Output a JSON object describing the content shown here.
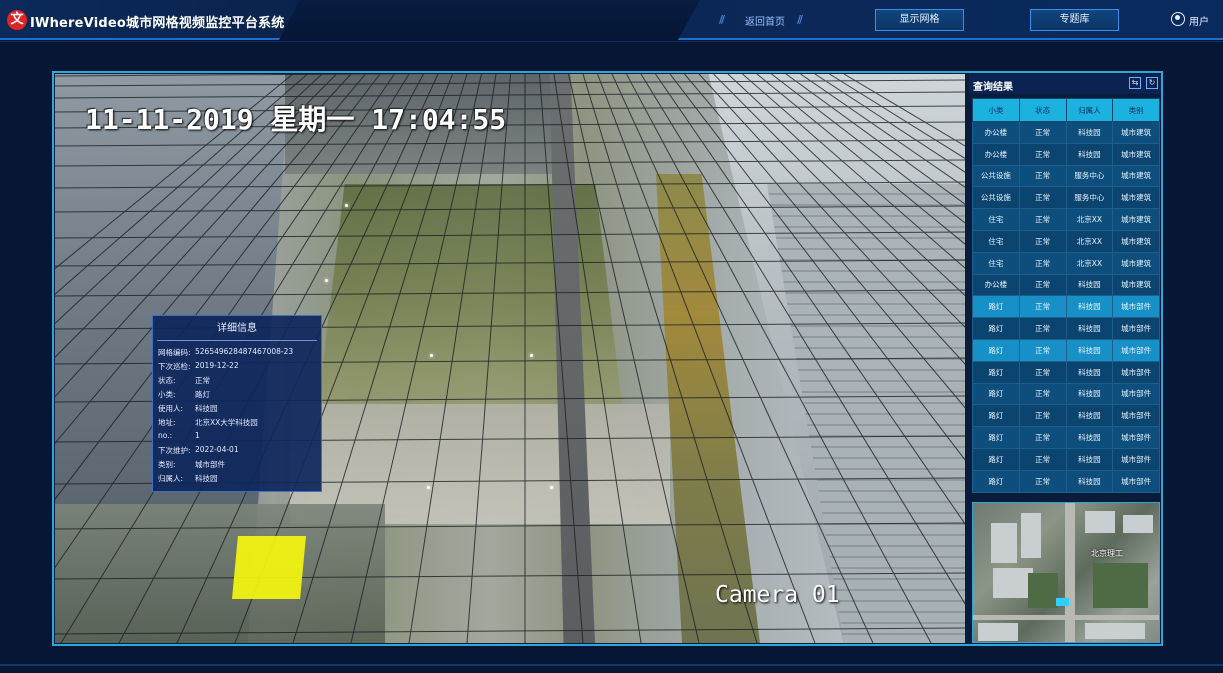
{
  "header": {
    "logo_glyph": "文",
    "app_title": "IWhereVideo城市网格视频监控平台系统",
    "nav_back": "返回首页",
    "btn_show_grid": "显示网格",
    "btn_topic_db": "专题库",
    "user_label": "用户"
  },
  "video": {
    "timestamp": "11-11-2019 星期一 17:04:55",
    "camera_label": "Camera 01"
  },
  "detail": {
    "title": "详细信息",
    "rows": [
      {
        "k": "网格编码:",
        "v": "526549628487467008-23"
      },
      {
        "k": "下次巡检:",
        "v": "2019-12-22"
      },
      {
        "k": "状态:",
        "v": "正常"
      },
      {
        "k": "小类:",
        "v": "路灯"
      },
      {
        "k": "使用人:",
        "v": "科技园"
      },
      {
        "k": "地址:",
        "v": "北京XX大学科技园"
      },
      {
        "k": "no.:",
        "v": "1"
      },
      {
        "k": "下次维护:",
        "v": "2022-04-01"
      },
      {
        "k": "类别:",
        "v": "城市部件"
      },
      {
        "k": "归属人:",
        "v": "科技园"
      }
    ]
  },
  "query": {
    "title": "查询结果",
    "columns": [
      "小类",
      "状态",
      "归属人",
      "类别"
    ],
    "rows": [
      [
        "办公楼",
        "正常",
        "科技园",
        "城市建筑"
      ],
      [
        "办公楼",
        "正常",
        "科技园",
        "城市建筑"
      ],
      [
        "公共设施",
        "正常",
        "服务中心",
        "城市建筑"
      ],
      [
        "公共设施",
        "正常",
        "服务中心",
        "城市建筑"
      ],
      [
        "住宅",
        "正常",
        "北京XX",
        "城市建筑"
      ],
      [
        "住宅",
        "正常",
        "北京XX",
        "城市建筑"
      ],
      [
        "住宅",
        "正常",
        "北京XX",
        "城市建筑"
      ],
      [
        "办公楼",
        "正常",
        "科技园",
        "城市建筑"
      ],
      [
        "路灯",
        "正常",
        "科技园",
        "城市部件"
      ],
      [
        "路灯",
        "正常",
        "科技园",
        "城市部件"
      ],
      [
        "路灯",
        "正常",
        "科技园",
        "城市部件"
      ],
      [
        "路灯",
        "正常",
        "科技园",
        "城市部件"
      ],
      [
        "路灯",
        "正常",
        "科技园",
        "城市部件"
      ],
      [
        "路灯",
        "正常",
        "科技园",
        "城市部件"
      ],
      [
        "路灯",
        "正常",
        "科技园",
        "城市部件"
      ],
      [
        "路灯",
        "正常",
        "科技园",
        "城市部件"
      ],
      [
        "路灯",
        "正常",
        "科技园",
        "城市部件"
      ]
    ],
    "selected_rows": [
      8,
      10
    ]
  },
  "minimap": {
    "label": "北京理工"
  },
  "colors": {
    "accent": "#1cb2e0",
    "highlight_cell": "#f4f70e",
    "background": "#061634"
  },
  "icons": [
    "logo-icon",
    "user-icon",
    "swap-icon",
    "refresh-icon"
  ]
}
